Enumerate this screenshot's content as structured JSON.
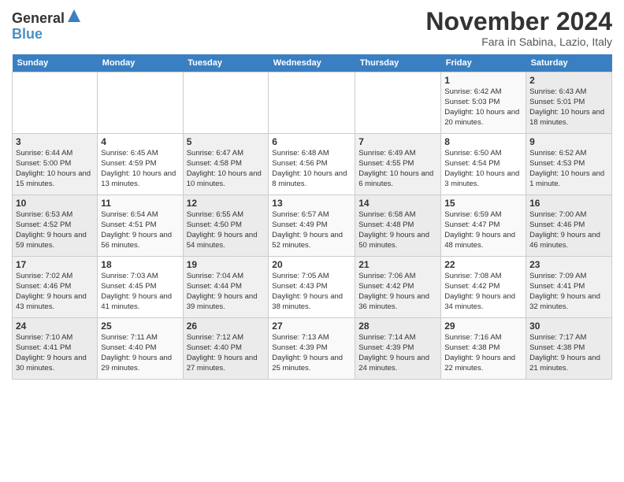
{
  "logo": {
    "line1": "General",
    "line2": "Blue"
  },
  "title": "November 2024",
  "subtitle": "Fara in Sabina, Lazio, Italy",
  "days_of_week": [
    "Sunday",
    "Monday",
    "Tuesday",
    "Wednesday",
    "Thursday",
    "Friday",
    "Saturday"
  ],
  "weeks": [
    [
      {
        "day": "",
        "info": ""
      },
      {
        "day": "",
        "info": ""
      },
      {
        "day": "",
        "info": ""
      },
      {
        "day": "",
        "info": ""
      },
      {
        "day": "",
        "info": ""
      },
      {
        "day": "1",
        "info": "Sunrise: 6:42 AM\nSunset: 5:03 PM\nDaylight: 10 hours and 20 minutes."
      },
      {
        "day": "2",
        "info": "Sunrise: 6:43 AM\nSunset: 5:01 PM\nDaylight: 10 hours and 18 minutes."
      }
    ],
    [
      {
        "day": "3",
        "info": "Sunrise: 6:44 AM\nSunset: 5:00 PM\nDaylight: 10 hours and 15 minutes."
      },
      {
        "day": "4",
        "info": "Sunrise: 6:45 AM\nSunset: 4:59 PM\nDaylight: 10 hours and 13 minutes."
      },
      {
        "day": "5",
        "info": "Sunrise: 6:47 AM\nSunset: 4:58 PM\nDaylight: 10 hours and 10 minutes."
      },
      {
        "day": "6",
        "info": "Sunrise: 6:48 AM\nSunset: 4:56 PM\nDaylight: 10 hours and 8 minutes."
      },
      {
        "day": "7",
        "info": "Sunrise: 6:49 AM\nSunset: 4:55 PM\nDaylight: 10 hours and 6 minutes."
      },
      {
        "day": "8",
        "info": "Sunrise: 6:50 AM\nSunset: 4:54 PM\nDaylight: 10 hours and 3 minutes."
      },
      {
        "day": "9",
        "info": "Sunrise: 6:52 AM\nSunset: 4:53 PM\nDaylight: 10 hours and 1 minute."
      }
    ],
    [
      {
        "day": "10",
        "info": "Sunrise: 6:53 AM\nSunset: 4:52 PM\nDaylight: 9 hours and 59 minutes."
      },
      {
        "day": "11",
        "info": "Sunrise: 6:54 AM\nSunset: 4:51 PM\nDaylight: 9 hours and 56 minutes."
      },
      {
        "day": "12",
        "info": "Sunrise: 6:55 AM\nSunset: 4:50 PM\nDaylight: 9 hours and 54 minutes."
      },
      {
        "day": "13",
        "info": "Sunrise: 6:57 AM\nSunset: 4:49 PM\nDaylight: 9 hours and 52 minutes."
      },
      {
        "day": "14",
        "info": "Sunrise: 6:58 AM\nSunset: 4:48 PM\nDaylight: 9 hours and 50 minutes."
      },
      {
        "day": "15",
        "info": "Sunrise: 6:59 AM\nSunset: 4:47 PM\nDaylight: 9 hours and 48 minutes."
      },
      {
        "day": "16",
        "info": "Sunrise: 7:00 AM\nSunset: 4:46 PM\nDaylight: 9 hours and 46 minutes."
      }
    ],
    [
      {
        "day": "17",
        "info": "Sunrise: 7:02 AM\nSunset: 4:46 PM\nDaylight: 9 hours and 43 minutes."
      },
      {
        "day": "18",
        "info": "Sunrise: 7:03 AM\nSunset: 4:45 PM\nDaylight: 9 hours and 41 minutes."
      },
      {
        "day": "19",
        "info": "Sunrise: 7:04 AM\nSunset: 4:44 PM\nDaylight: 9 hours and 39 minutes."
      },
      {
        "day": "20",
        "info": "Sunrise: 7:05 AM\nSunset: 4:43 PM\nDaylight: 9 hours and 38 minutes."
      },
      {
        "day": "21",
        "info": "Sunrise: 7:06 AM\nSunset: 4:42 PM\nDaylight: 9 hours and 36 minutes."
      },
      {
        "day": "22",
        "info": "Sunrise: 7:08 AM\nSunset: 4:42 PM\nDaylight: 9 hours and 34 minutes."
      },
      {
        "day": "23",
        "info": "Sunrise: 7:09 AM\nSunset: 4:41 PM\nDaylight: 9 hours and 32 minutes."
      }
    ],
    [
      {
        "day": "24",
        "info": "Sunrise: 7:10 AM\nSunset: 4:41 PM\nDaylight: 9 hours and 30 minutes."
      },
      {
        "day": "25",
        "info": "Sunrise: 7:11 AM\nSunset: 4:40 PM\nDaylight: 9 hours and 29 minutes."
      },
      {
        "day": "26",
        "info": "Sunrise: 7:12 AM\nSunset: 4:40 PM\nDaylight: 9 hours and 27 minutes."
      },
      {
        "day": "27",
        "info": "Sunrise: 7:13 AM\nSunset: 4:39 PM\nDaylight: 9 hours and 25 minutes."
      },
      {
        "day": "28",
        "info": "Sunrise: 7:14 AM\nSunset: 4:39 PM\nDaylight: 9 hours and 24 minutes."
      },
      {
        "day": "29",
        "info": "Sunrise: 7:16 AM\nSunset: 4:38 PM\nDaylight: 9 hours and 22 minutes."
      },
      {
        "day": "30",
        "info": "Sunrise: 7:17 AM\nSunset: 4:38 PM\nDaylight: 9 hours and 21 minutes."
      }
    ]
  ]
}
